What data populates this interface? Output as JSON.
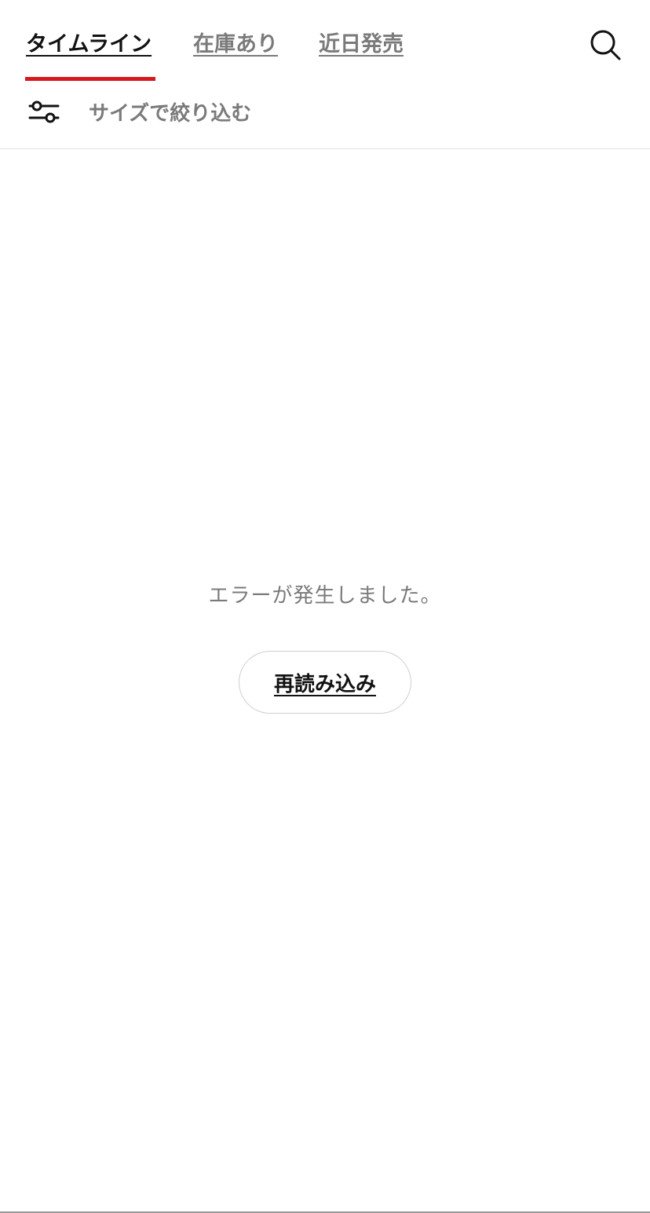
{
  "tabs": [
    {
      "label": "タイムライン",
      "active": true
    },
    {
      "label": "在庫あり",
      "active": false
    },
    {
      "label": "近日発売",
      "active": false
    }
  ],
  "header": {
    "search_icon": "search-icon",
    "filter_icon": "sliders-icon",
    "filter_label": "サイズで絞り込む"
  },
  "main": {
    "error_message": "エラーが発生しました。",
    "reload_label": "再読み込み"
  },
  "colors": {
    "accent": "#d7191f",
    "text_primary": "#111111",
    "text_secondary": "#7a7a7a",
    "divider": "#e2e2e2"
  }
}
